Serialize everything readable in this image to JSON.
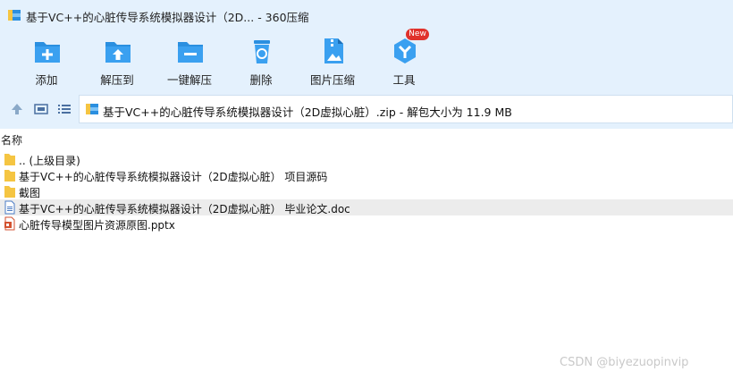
{
  "window": {
    "title": "基于VC++的心脏传导系统模拟器设计（2D... - 360压缩",
    "app_icon": "archive-app-icon"
  },
  "toolbar": {
    "buttons": [
      {
        "label": "添加",
        "icon": "add-icon"
      },
      {
        "label": "解压到",
        "icon": "extract-to-icon"
      },
      {
        "label": "一键解压",
        "icon": "one-click-extract-icon"
      },
      {
        "label": "删除",
        "icon": "delete-icon"
      },
      {
        "label": "图片压缩",
        "icon": "image-compress-icon"
      },
      {
        "label": "工具",
        "icon": "tools-icon",
        "badge": "New"
      }
    ]
  },
  "address": {
    "text": "基于VC++的心脏传导系统模拟器设计（2D虚拟心脏）.zip - 解包大小为 11.9 MB"
  },
  "filelist": {
    "column_name": "名称",
    "rows": [
      {
        "name": ".. (上级目录)",
        "type": "folder"
      },
      {
        "name": "基于VC++的心脏传导系统模拟器设计（2D虚拟心脏） 项目源码",
        "type": "folder"
      },
      {
        "name": "截图",
        "type": "folder"
      },
      {
        "name": "基于VC++的心脏传导系统模拟器设计（2D虚拟心脏） 毕业论文.doc",
        "type": "doc",
        "selected": true
      },
      {
        "name": "心脏传导模型图片资源原图.pptx",
        "type": "pptx"
      }
    ]
  },
  "watermark": "CSDN @biyezuopinvip",
  "colors": {
    "toolbar_bg": "#e4f1fd",
    "icon_blue": "#2a8fe0",
    "badge_red": "#e0322c",
    "folder_yellow": "#f5c542",
    "selected_row": "#ececec"
  }
}
